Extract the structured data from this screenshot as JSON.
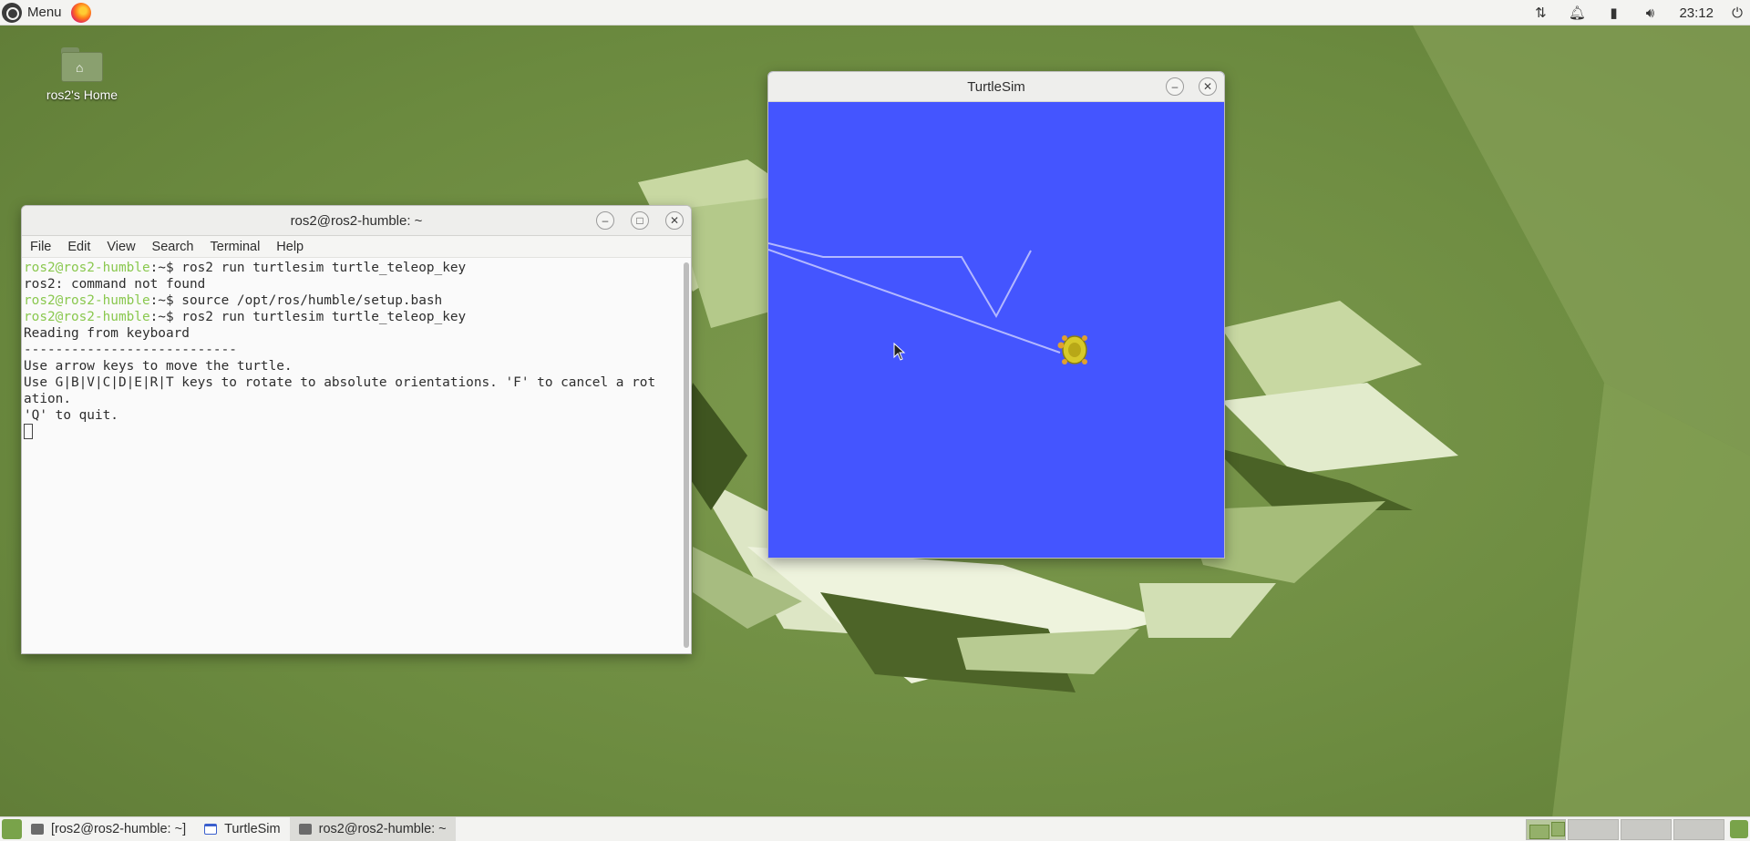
{
  "top_panel": {
    "menu_label": "Menu",
    "clock": "23:12",
    "tray_icons": [
      "network-icon",
      "notification-bell-icon",
      "battery-icon",
      "volume-icon",
      "power-icon"
    ]
  },
  "desktop": {
    "home_icon_label": "ros2's Home"
  },
  "terminal": {
    "title": "ros2@ros2-humble: ~",
    "menu": [
      "File",
      "Edit",
      "View",
      "Search",
      "Terminal",
      "Help"
    ],
    "lines": [
      {
        "user": "ros2@ros2-humble",
        "path": ":~$ ",
        "cmd": "ros2 run turtlesim turtle_teleop_key"
      },
      {
        "text": "ros2: command not found"
      },
      {
        "user": "ros2@ros2-humble",
        "path": ":~$ ",
        "cmd": "source /opt/ros/humble/setup.bash"
      },
      {
        "user": "ros2@ros2-humble",
        "path": ":~$ ",
        "cmd": "ros2 run turtlesim turtle_teleop_key"
      },
      {
        "text": "Reading from keyboard"
      },
      {
        "text": "---------------------------"
      },
      {
        "text": "Use arrow keys to move the turtle."
      },
      {
        "text": "Use G|B|V|C|D|E|R|T keys to rotate to absolute orientations. 'F' to cancel a rot"
      },
      {
        "text": "ation."
      },
      {
        "text": "'Q' to quit."
      }
    ]
  },
  "turtlesim": {
    "title": "TurtleSim",
    "background_color": "#4455ff",
    "pen_color": "#b3b8ff"
  },
  "taskbar": {
    "tasks": [
      {
        "label": "[ros2@ros2-humble: ~]",
        "icon": "terminal-icon",
        "active": false
      },
      {
        "label": "TurtleSim",
        "icon": "window-icon",
        "active": false
      },
      {
        "label": "ros2@ros2-humble: ~",
        "icon": "terminal-icon",
        "active": true
      }
    ]
  }
}
